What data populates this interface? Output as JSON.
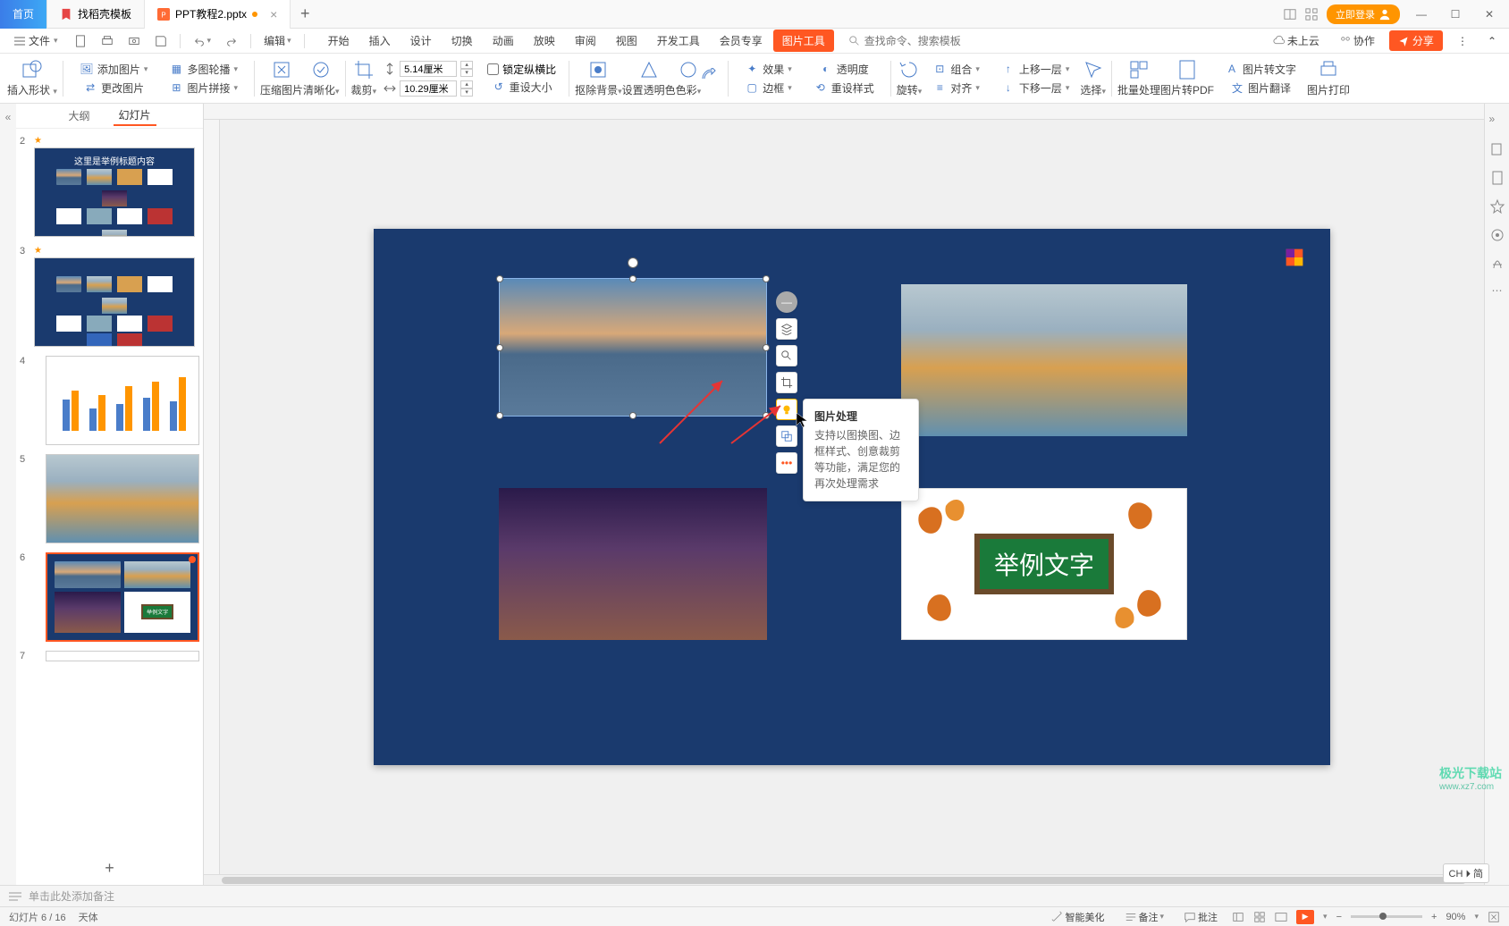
{
  "titlebar": {
    "home": "首页",
    "tab1": "找稻壳模板",
    "tab2": "PPT教程2.pptx",
    "login": "立即登录"
  },
  "menubar": {
    "file": "文件",
    "quick": {
      "edit": "编辑"
    },
    "tabs": [
      "开始",
      "插入",
      "设计",
      "切换",
      "动画",
      "放映",
      "审阅",
      "视图",
      "开发工具",
      "会员专享",
      "图片工具"
    ],
    "active_tab": "图片工具",
    "search_placeholder": "查找命令、搜索模板",
    "cloud": "未上云",
    "collab": "协作",
    "share": "分享"
  },
  "ribbon": {
    "insert_shape": "插入形状",
    "add_img": "添加图片",
    "multi_outline": "多图轮播",
    "change_img": "更改图片",
    "img_splice": "图片拼接",
    "compress": "压缩图片",
    "clarity": "清晰化",
    "crop": "裁剪",
    "h_label": "高",
    "h_val": "5.14厘米",
    "w_label": "宽",
    "w_val": "10.29厘米",
    "lock_ratio": "锁定纵横比",
    "reset_size": "重设大小",
    "remove_bg": "抠除背景",
    "set_trans": "设置透明色",
    "color": "色彩",
    "effect": "效果",
    "border": "边框",
    "transparency": "透明度",
    "reset_style": "重设样式",
    "rotate": "旋转",
    "group": "组合",
    "align": "对齐",
    "move_up": "上移一层",
    "move_down": "下移一层",
    "select": "选择",
    "batch": "批量处理",
    "to_pdf": "图片转PDF",
    "to_text": "图片转文字",
    "translate": "图片翻译",
    "print": "图片打印"
  },
  "slides_panel": {
    "outline": "大纲",
    "slides": "幻灯片",
    "nums": [
      "2",
      "3",
      "4",
      "5",
      "6",
      "7"
    ],
    "slide2_title": "这里是举例标题内容",
    "slide6_label": "举例文字"
  },
  "canvas": {
    "leaf_text": "举例文字",
    "tooltip_title": "图片处理",
    "tooltip_body": "支持以图换图、边框样式、创意裁剪等功能，满足您的再次处理需求"
  },
  "notes": "单击此处添加备注",
  "status": {
    "page": "幻灯片 6 / 16",
    "font": "天体",
    "beauty": "智能美化",
    "remark": "备注",
    "comment": "批注",
    "zoom": "90%",
    "ime": "CH ⏵ 简"
  },
  "watermark": {
    "l1": "极光下载站",
    "l2": "www.xz7.com"
  }
}
